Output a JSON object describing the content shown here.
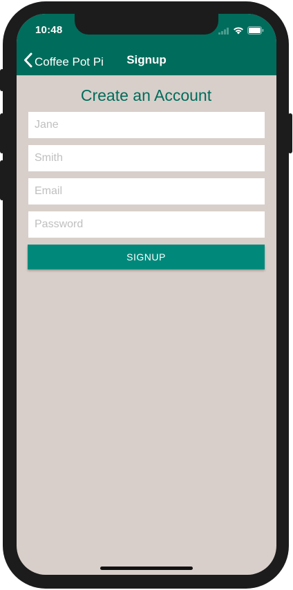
{
  "status_bar": {
    "time": "10:48",
    "icons": [
      "cellular-signal-icon",
      "wifi-icon",
      "battery-icon"
    ]
  },
  "nav_bar": {
    "back_label": "Coffee Pot Pi",
    "title": "Signup"
  },
  "form": {
    "heading": "Create an Account",
    "fields": [
      {
        "name": "first-name",
        "placeholder": "Jane",
        "value": ""
      },
      {
        "name": "last-name",
        "placeholder": "Smith",
        "value": ""
      },
      {
        "name": "email",
        "placeholder": "Email",
        "value": ""
      },
      {
        "name": "password",
        "placeholder": "Password",
        "value": ""
      }
    ],
    "submit_label": "SIGNUP"
  },
  "colors": {
    "nav_background": "#006c5b",
    "screen_background": "#d8cfca",
    "button": "#00897b",
    "heading": "#006c5b"
  }
}
